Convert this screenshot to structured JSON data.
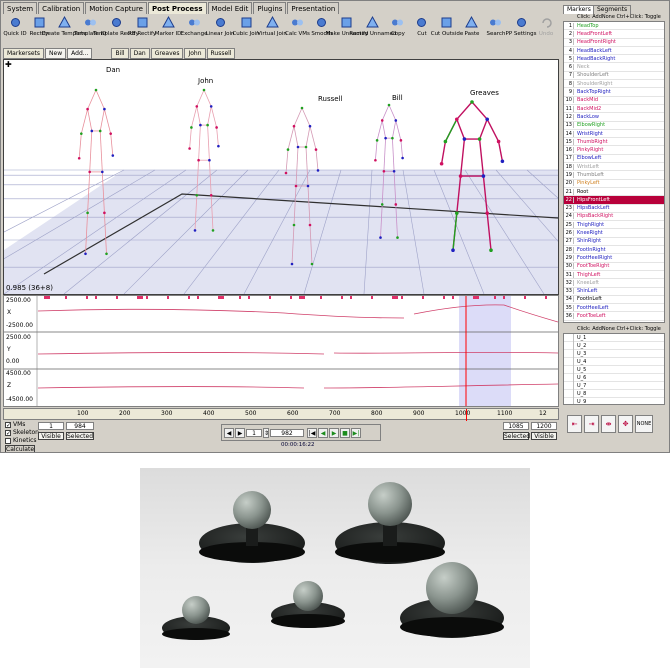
{
  "top_tabs": [
    "System",
    "Calibration",
    "Motion Capture",
    "Post Process",
    "Model Edit",
    "Plugins",
    "Presentation"
  ],
  "active_top_tab": "Post Process",
  "toolbar": [
    {
      "icon": "quick-id-icon",
      "label": "Quick ID"
    },
    {
      "icon": "rectify-icon",
      "label": "Rectify"
    },
    {
      "icon": "create-template-icon",
      "label": "Create Template"
    },
    {
      "icon": "template-id-icon",
      "label": "Template ID"
    },
    {
      "icon": "template-rectify-icon",
      "label": "Template Rectify"
    },
    {
      "icon": "rb-rectify-icon",
      "label": "RB Rectify"
    },
    {
      "icon": "marker-id-icon",
      "label": "Marker ID"
    },
    {
      "icon": "exchange-icon",
      "label": "Exchange"
    },
    {
      "icon": "linear-join-icon",
      "label": "Linear Join"
    },
    {
      "icon": "cubic-join-icon",
      "label": "Cubic Join"
    },
    {
      "icon": "virtual-join-icon",
      "label": "Virtual Join"
    },
    {
      "icon": "calc-vms-icon",
      "label": "Calc VMs"
    },
    {
      "icon": "smooth-icon",
      "label": "Smooth"
    },
    {
      "icon": "make-unnamed-icon",
      "label": "Make Unnamed"
    },
    {
      "icon": "rectify-unnamed-icon",
      "label": "Rectify Unnamed"
    },
    {
      "icon": "copy-icon",
      "label": "Copy"
    },
    {
      "icon": "cut-icon",
      "label": "Cut"
    },
    {
      "icon": "cut-outside-icon",
      "label": "Cut Outside"
    },
    {
      "icon": "paste-icon",
      "label": "Paste"
    },
    {
      "icon": "search-icon",
      "label": "Search"
    },
    {
      "icon": "pp-settings-icon",
      "label": "PP Settings"
    },
    {
      "icon": "undo-icon",
      "label": "Undo"
    }
  ],
  "sub_tabs": {
    "markersets": "Markersets",
    "new_button": "New",
    "add_button": "Add...",
    "actors": [
      "Bill",
      "Dan",
      "Greaves",
      "John",
      "Russell"
    ]
  },
  "viewport": {
    "actors": [
      "Dan",
      "John",
      "Russell",
      "Bill",
      "Greaves"
    ],
    "frame_readout": "0.985 (36+8)"
  },
  "graph": {
    "x_axis_name": "X",
    "y_axis_name": "Y",
    "z_axis_name": "Z",
    "x_labels": [
      "2500.00",
      "-2500.00"
    ],
    "y_labels": [
      "2500.00",
      "0.00"
    ],
    "z_labels": [
      "4500.00",
      "-4500.00"
    ]
  },
  "timeline": {
    "ticks": [
      "100",
      "200",
      "300",
      "400",
      "500",
      "600",
      "700",
      "800",
      "900",
      "1000",
      "1100",
      "12"
    ]
  },
  "controls": {
    "checkboxes": [
      {
        "label": "VMs",
        "checked": true
      },
      {
        "label": "Skeleton",
        "checked": true
      },
      {
        "label": "Kinetics",
        "checked": false
      }
    ],
    "calculate_button": "Calculate",
    "left_range": {
      "start": "1",
      "end": "984",
      "visible_btn": "Visible",
      "selected_btn": "Selected"
    },
    "right_range": {
      "start": "1085",
      "end": "1200",
      "selected_btn": "Selected",
      "visible_btn": "Visible"
    },
    "frame_value": "982",
    "step_value": "1",
    "time_readout": "00:00:16:22"
  },
  "right_panel": {
    "tabs": [
      "Markers",
      "Segments"
    ],
    "hint_top": "Click: AddNone  Ctrl+Click: Toggle",
    "hint_bottom": "Click: AddNone  Ctrl+Click: Toggle",
    "markers": [
      {
        "n": "1",
        "name": "HeadTop",
        "color": "#20a020"
      },
      {
        "n": "2",
        "name": "HeadFrontLeft",
        "color": "#d01060"
      },
      {
        "n": "3",
        "name": "HeadFrontRight",
        "color": "#d01060"
      },
      {
        "n": "4",
        "name": "HeadBackLeft",
        "color": "#2020c0"
      },
      {
        "n": "5",
        "name": "HeadBackRight",
        "color": "#2020c0"
      },
      {
        "n": "6",
        "name": "Neck",
        "color": "#a0a0a0"
      },
      {
        "n": "7",
        "name": "ShoulderLeft",
        "color": "#808080"
      },
      {
        "n": "8",
        "name": "ShoulderRight",
        "color": "#a0a0a0"
      },
      {
        "n": "9",
        "name": "BackTopRight",
        "color": "#2020c0"
      },
      {
        "n": "10",
        "name": "BackMid",
        "color": "#d01060"
      },
      {
        "n": "11",
        "name": "BackMid2",
        "color": "#d01060"
      },
      {
        "n": "12",
        "name": "BackLow",
        "color": "#2020c0"
      },
      {
        "n": "13",
        "name": "ElbowRight",
        "color": "#20a020"
      },
      {
        "n": "14",
        "name": "WristRight",
        "color": "#2020c0"
      },
      {
        "n": "15",
        "name": "ThumbRight",
        "color": "#d01060"
      },
      {
        "n": "16",
        "name": "PinkyRight",
        "color": "#d01060"
      },
      {
        "n": "17",
        "name": "ElbowLeft",
        "color": "#2020c0"
      },
      {
        "n": "18",
        "name": "WristLeft",
        "color": "#a0a0a0"
      },
      {
        "n": "19",
        "name": "ThumbLeft",
        "color": "#808080"
      },
      {
        "n": "20",
        "name": "PinkyLeft",
        "color": "#d08020"
      },
      {
        "n": "21",
        "name": "Root",
        "color": "#000000"
      },
      {
        "n": "22",
        "name": "HipsFrontLeft",
        "color": "#ffffff",
        "selected": true
      },
      {
        "n": "23",
        "name": "HipsBackLeft",
        "color": "#2020c0"
      },
      {
        "n": "24",
        "name": "HipsBackRight",
        "color": "#d01060"
      },
      {
        "n": "25",
        "name": "ThighRight",
        "color": "#2020c0"
      },
      {
        "n": "26",
        "name": "KneeRight",
        "color": "#2020c0"
      },
      {
        "n": "27",
        "name": "ShinRight",
        "color": "#2020c0"
      },
      {
        "n": "28",
        "name": "FootInRight",
        "color": "#2020c0"
      },
      {
        "n": "29",
        "name": "FootHeelRight",
        "color": "#2020c0"
      },
      {
        "n": "30",
        "name": "FootToeRight",
        "color": "#d01060"
      },
      {
        "n": "31",
        "name": "ThighLeft",
        "color": "#d01060"
      },
      {
        "n": "32",
        "name": "KneeLeft",
        "color": "#a0a0a0"
      },
      {
        "n": "33",
        "name": "ShinLeft",
        "color": "#2020c0"
      },
      {
        "n": "34",
        "name": "FootInLeft",
        "color": "#000000"
      },
      {
        "n": "35",
        "name": "FootHeelLeft",
        "color": "#2020c0"
      },
      {
        "n": "36",
        "name": "FootToeLeft",
        "color": "#d01060"
      }
    ],
    "unnamed": [
      "U_1",
      "U_2",
      "U_3",
      "U_4",
      "U_5",
      "U_6",
      "U_7",
      "U_8",
      "U_9"
    ],
    "none_button": "NONE"
  },
  "colors": {
    "accent_selected": "#b8003a",
    "graph_curve": "#d0406a",
    "selection_band": "#dcdcf8",
    "playhead": "#ff0000"
  }
}
